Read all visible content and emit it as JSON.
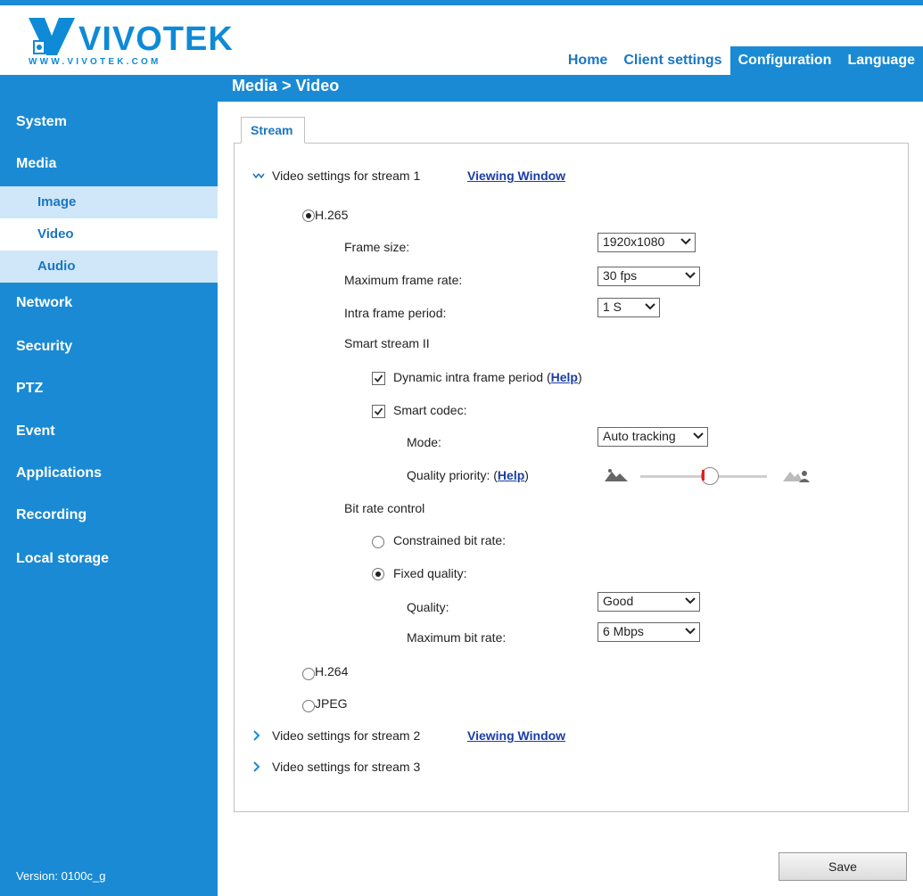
{
  "brand": {
    "logo_text": "VIVOTEK",
    "logo_url": "WWW.VIVOTEK.COM",
    "color": "#0e8ad6"
  },
  "nav": {
    "home": "Home",
    "client_settings": "Client settings",
    "configuration": "Configuration",
    "language": "Language"
  },
  "breadcrumb": "Media  > Video",
  "sidebar": {
    "items": [
      {
        "label": "System"
      },
      {
        "label": "Media"
      },
      {
        "label": "Network"
      },
      {
        "label": "Security"
      },
      {
        "label": "PTZ"
      },
      {
        "label": "Event"
      },
      {
        "label": "Applications"
      },
      {
        "label": "Recording"
      },
      {
        "label": "Local storage"
      }
    ],
    "media_sub": [
      {
        "label": "Image"
      },
      {
        "label": "Video"
      },
      {
        "label": "Audio"
      }
    ],
    "version": "Version: 0100c_g"
  },
  "tab": {
    "label": "Stream"
  },
  "stream1": {
    "title": "Video settings for stream 1",
    "viewing_window": "Viewing Window",
    "codec_h265": "H.265",
    "frame_size_label": "Frame size:",
    "frame_size_value": "1920x1080",
    "max_frame_rate_label": "Maximum frame rate:",
    "max_frame_rate_value": "30 fps",
    "intra_frame_label": "Intra frame period:",
    "intra_frame_value": "1 S",
    "smart_stream": "Smart stream II",
    "dynamic_intra_label": "Dynamic intra frame period (",
    "help": "Help",
    "close_paren": ")",
    "smart_codec_label": "Smart codec:",
    "mode_label": "Mode:",
    "mode_value": "Auto tracking",
    "quality_priority_label": "Quality priority: (",
    "quality_priority_level": 0.55,
    "bit_rate_control": "Bit rate control",
    "constrained_label": "Constrained bit rate:",
    "fixed_quality_label": "Fixed quality:",
    "quality_label": "Quality:",
    "quality_value": "Good",
    "max_bit_rate_label": "Maximum bit rate:",
    "max_bit_rate_value": "6 Mbps",
    "codec_h264": "H.264",
    "codec_jpeg": "JPEG"
  },
  "stream2": {
    "title": "Video settings for stream 2",
    "viewing_window": "Viewing Window"
  },
  "stream3": {
    "title": "Video settings for stream 3"
  },
  "save_label": "Save"
}
